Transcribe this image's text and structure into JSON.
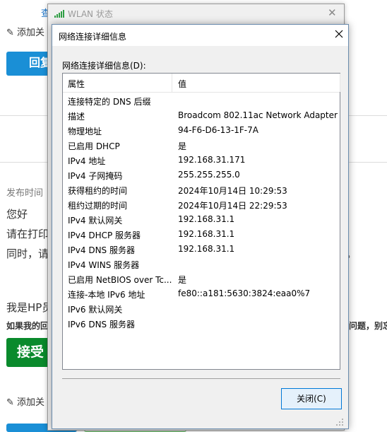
{
  "background_page": {
    "add_related_1": "添加关",
    "reply_button": "回复",
    "post_time_label": "发布时间",
    "greeting": "您好",
    "line_1": "请在打印",
    "line_2": "同时，请",
    "line_2_tail": "。",
    "hp_intro": "我是HP员",
    "bold_line": "如果我的回",
    "bold_tail": "问题，别忘",
    "accept_button": "接受",
    "add_related_2": "添加关",
    "top_link": "查"
  },
  "wlan_window": {
    "title": "WLAN 状态"
  },
  "dialog": {
    "title": "网络连接详细信息",
    "list_label": "网络连接详细信息(D):",
    "columns": [
      "属性",
      "值"
    ],
    "rows": [
      {
        "property": "连接特定的 DNS 后缀",
        "value": ""
      },
      {
        "property": "描述",
        "value": "Broadcom 802.11ac Network Adapter"
      },
      {
        "property": "物理地址",
        "value": "94-F6-D6-13-1F-7A"
      },
      {
        "property": "已启用 DHCP",
        "value": "是"
      },
      {
        "property": "IPv4 地址",
        "value": "192.168.31.171"
      },
      {
        "property": "IPv4 子网掩码",
        "value": "255.255.255.0"
      },
      {
        "property": "获得租约的时间",
        "value": "2024年10月14日 10:29:53"
      },
      {
        "property": "租约过期的时间",
        "value": "2024年10月14日 22:29:53"
      },
      {
        "property": "IPv4 默认网关",
        "value": "192.168.31.1"
      },
      {
        "property": "IPv4 DHCP 服务器",
        "value": "192.168.31.1"
      },
      {
        "property": "IPv4 DNS 服务器",
        "value": "192.168.31.1"
      },
      {
        "property": "IPv4 WINS 服务器",
        "value": ""
      },
      {
        "property": "已启用 NetBIOS over Tc...",
        "value": "是"
      },
      {
        "property": "连接-本地 IPv6 地址",
        "value": "fe80::a181:5630:3824:eaa0%7"
      },
      {
        "property": "IPv6 默认网关",
        "value": ""
      },
      {
        "property": "IPv6 DNS 服务器",
        "value": ""
      }
    ],
    "close_button": "关闭(C)"
  }
}
